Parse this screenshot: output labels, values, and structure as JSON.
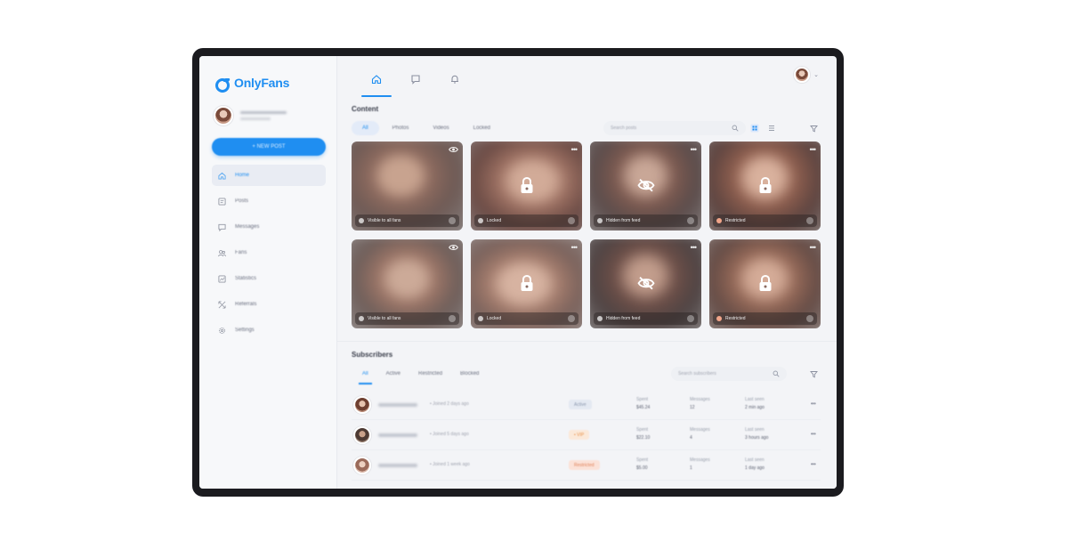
{
  "app": {
    "logo_text": "OnlyFans",
    "brand_color": "#1f8ef1"
  },
  "sidebar": {
    "new_post_label": "+ NEW POST",
    "items": [
      {
        "label": "Home",
        "icon": "home-icon",
        "active": true
      },
      {
        "label": "Posts",
        "icon": "posts-icon",
        "active": false
      },
      {
        "label": "Messages",
        "icon": "messages-icon",
        "active": false
      },
      {
        "label": "Fans",
        "icon": "fans-icon",
        "active": false
      },
      {
        "label": "Statistics",
        "icon": "statistics-icon",
        "active": false
      },
      {
        "label": "Referrals",
        "icon": "referrals-icon",
        "active": false
      },
      {
        "label": "Settings",
        "icon": "settings-icon",
        "active": false
      }
    ]
  },
  "topbar": {
    "tabs": [
      "home-icon",
      "chat-icon",
      "bell-icon"
    ]
  },
  "content": {
    "title": "Content",
    "filters": [
      "All",
      "Photos",
      "Videos",
      "Locked"
    ],
    "search_placeholder": "Search posts",
    "cards": [
      {
        "status": "Visible to all fans",
        "icon": "eye-icon"
      },
      {
        "status": "Locked",
        "icon": "lock-icon"
      },
      {
        "status": "Hidden from feed",
        "icon": "eye-off-icon"
      },
      {
        "status": "Restricted",
        "icon": "lock-icon"
      },
      {
        "status": "Visible to all fans",
        "icon": "eye-icon"
      },
      {
        "status": "Locked",
        "icon": "lock-icon"
      },
      {
        "status": "Hidden from feed",
        "icon": "eye-off-icon"
      },
      {
        "status": "Restricted",
        "icon": "lock-icon"
      }
    ]
  },
  "subscribers": {
    "title": "Subscribers",
    "tabs": [
      "All",
      "Active",
      "Restricted",
      "Blocked"
    ],
    "search_placeholder": "Search subscribers",
    "rows": [
      {
        "time": "• Joined 2 days ago",
        "status": "Active",
        "status_color": "#e4e9f2",
        "status_text_color": "#8a97ad",
        "spent_label": "Spent",
        "spent": "$45.24",
        "messages_label": "Messages",
        "messages": "12",
        "last_seen_label": "Last seen",
        "last_seen": "2 min ago"
      },
      {
        "time": "• Joined 5 days ago",
        "status": "• VIP",
        "status_color": "#fbe9d9",
        "status_text_color": "#e8924a",
        "spent_label": "Spent",
        "spent": "$22.10",
        "messages_label": "Messages",
        "messages": "4",
        "last_seen_label": "Last seen",
        "last_seen": "3 hours ago"
      },
      {
        "time": "• Joined 1 week ago",
        "status": "Restricted",
        "status_color": "#fbe2d8",
        "status_text_color": "#e0845c",
        "spent_label": "Spent",
        "spent": "$5.00",
        "messages_label": "Messages",
        "messages": "1",
        "last_seen_label": "Last seen",
        "last_seen": "1 day ago"
      }
    ]
  }
}
